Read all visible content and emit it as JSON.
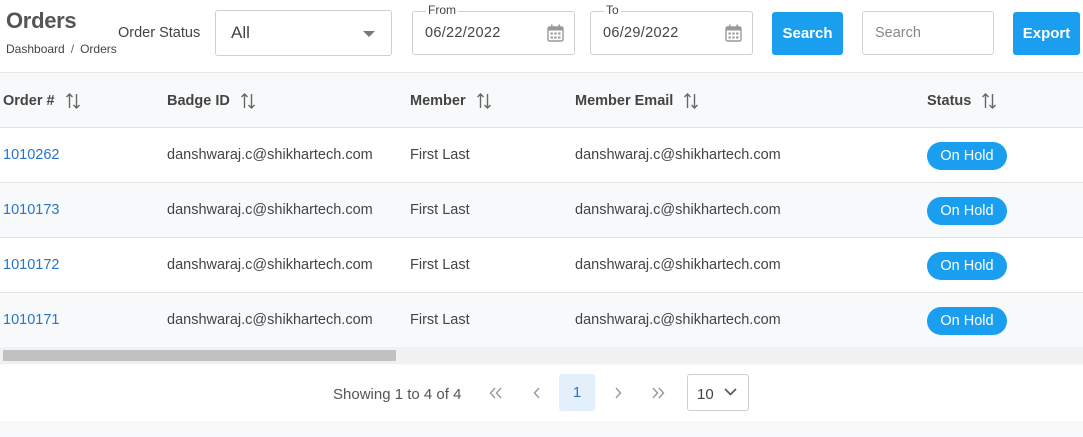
{
  "header": {
    "title": "Orders",
    "breadcrumb": [
      "Dashboard",
      "Orders"
    ]
  },
  "filters": {
    "status_label": "Order Status",
    "status_value": "All",
    "from_label": "From",
    "from_value": "06/22/2022",
    "to_label": "To",
    "to_value": "06/29/2022",
    "search_button": "Search",
    "search_placeholder": "Search",
    "export_button": "Export"
  },
  "table": {
    "columns": [
      "Order #",
      "Badge ID",
      "Member",
      "Member Email",
      "Status"
    ],
    "rows": [
      {
        "order": "1010262",
        "badge": "danshwaraj.c@shikhartech.com",
        "member": "First Last",
        "email": "danshwaraj.c@shikhartech.com",
        "status": "On Hold"
      },
      {
        "order": "1010173",
        "badge": "danshwaraj.c@shikhartech.com",
        "member": "First Last",
        "email": "danshwaraj.c@shikhartech.com",
        "status": "On Hold"
      },
      {
        "order": "1010172",
        "badge": "danshwaraj.c@shikhartech.com",
        "member": "First Last",
        "email": "danshwaraj.c@shikhartech.com",
        "status": "On Hold"
      },
      {
        "order": "1010171",
        "badge": "danshwaraj.c@shikhartech.com",
        "member": "First Last",
        "email": "danshwaraj.c@shikhartech.com",
        "status": "On Hold"
      }
    ]
  },
  "pagination": {
    "showing": "Showing 1 to 4 of 4",
    "first": "«",
    "prev": "‹",
    "current": "1",
    "next": "›",
    "last": "»",
    "per_page": "10"
  },
  "colors": {
    "accent": "#1a9ef0",
    "link": "#2476c8"
  }
}
